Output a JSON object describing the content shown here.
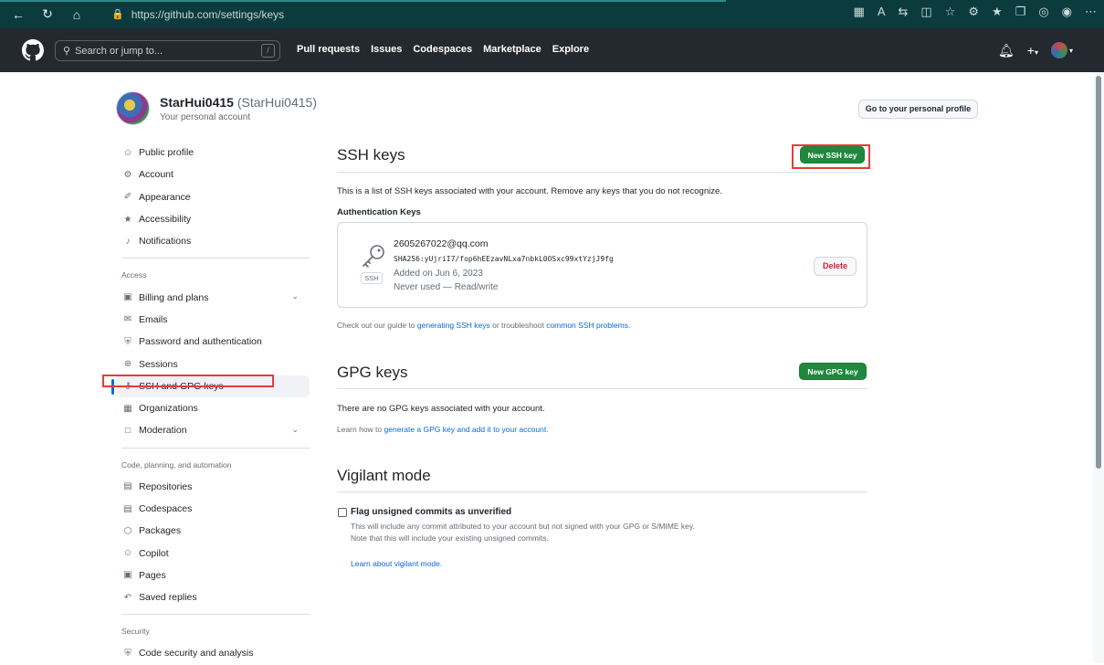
{
  "browser": {
    "url": "https://github.com/settings/keys",
    "back_icon": "arrow-left-icon",
    "refresh_icon": "refresh-icon",
    "home_icon": "home-icon"
  },
  "header": {
    "search_placeholder": "Search or jump to...",
    "search_shortcut": "/",
    "nav": [
      "Pull requests",
      "Issues",
      "Codespaces",
      "Marketplace",
      "Explore"
    ],
    "plus_label": "+"
  },
  "user": {
    "name": "StarHui0415",
    "login": "(StarHui0415)",
    "subtitle": "Your personal account",
    "profile_button": "Go to your personal profile"
  },
  "sidebar": {
    "group1": [
      {
        "label": "Public profile",
        "icon": "person-icon"
      },
      {
        "label": "Account",
        "icon": "gear-icon"
      },
      {
        "label": "Appearance",
        "icon": "paintbrush-icon"
      },
      {
        "label": "Accessibility",
        "icon": "accessibility-icon"
      },
      {
        "label": "Notifications",
        "icon": "bell-icon"
      }
    ],
    "access_heading": "Access",
    "group2": [
      {
        "label": "Billing and plans",
        "icon": "credit-card-icon",
        "chevron": true
      },
      {
        "label": "Emails",
        "icon": "mail-icon"
      },
      {
        "label": "Password and authentication",
        "icon": "shield-icon"
      },
      {
        "label": "Sessions",
        "icon": "broadcast-icon"
      },
      {
        "label": "SSH and GPG keys",
        "icon": "key-icon",
        "active": true
      },
      {
        "label": "Organizations",
        "icon": "organization-icon"
      },
      {
        "label": "Moderation",
        "icon": "report-icon",
        "chevron": true
      }
    ],
    "code_heading": "Code, planning, and automation",
    "group3": [
      {
        "label": "Repositories",
        "icon": "repo-icon"
      },
      {
        "label": "Codespaces",
        "icon": "codespaces-icon"
      },
      {
        "label": "Packages",
        "icon": "package-icon"
      },
      {
        "label": "Copilot",
        "icon": "copilot-icon"
      },
      {
        "label": "Pages",
        "icon": "browser-icon"
      },
      {
        "label": "Saved replies",
        "icon": "reply-icon"
      }
    ],
    "security_heading": "Security",
    "group4": [
      {
        "label": "Code security and analysis",
        "icon": "shield-lock-icon"
      }
    ]
  },
  "ssh": {
    "title": "SSH keys",
    "new_button": "New SSH key",
    "description": "This is a list of SSH keys associated with your account. Remove any keys that you do not recognize.",
    "auth_heading": "Authentication Keys",
    "key": {
      "badge": "SSH",
      "title": "2605267022@qq.com",
      "fingerprint": "SHA256:yUjriI7/fop6hEEzavNLxa7nbkL0OSxc99xtYzjJ9fg",
      "added": "Added on Jun 6, 2023",
      "used": "Never used — Read/write",
      "delete_button": "Delete"
    },
    "guide_prefix": "Check out our guide to ",
    "guide_link1": "generating SSH keys",
    "guide_middle": " or troubleshoot ",
    "guide_link2": "common SSH problems",
    "guide_suffix": "."
  },
  "gpg": {
    "title": "GPG keys",
    "new_button": "New GPG key",
    "empty": "There are no GPG keys associated with your account.",
    "learn_prefix": "Learn how to ",
    "learn_link": "generate a GPG key and add it to your account",
    "learn_suffix": "."
  },
  "vigilant": {
    "title": "Vigilant mode",
    "checkbox_label": "Flag unsigned commits as unverified",
    "desc1": "This will include any commit attributed to your account but not signed with your GPG or S/MIME key.",
    "desc2": "Note that this will include your existing unsigned commits.",
    "link": "Learn about vigilant mode."
  },
  "colors": {
    "green": "#1f883d",
    "link": "#0969da",
    "danger": "#cf222e",
    "header_bg": "#24292f",
    "highlight": "#e23d3d"
  }
}
